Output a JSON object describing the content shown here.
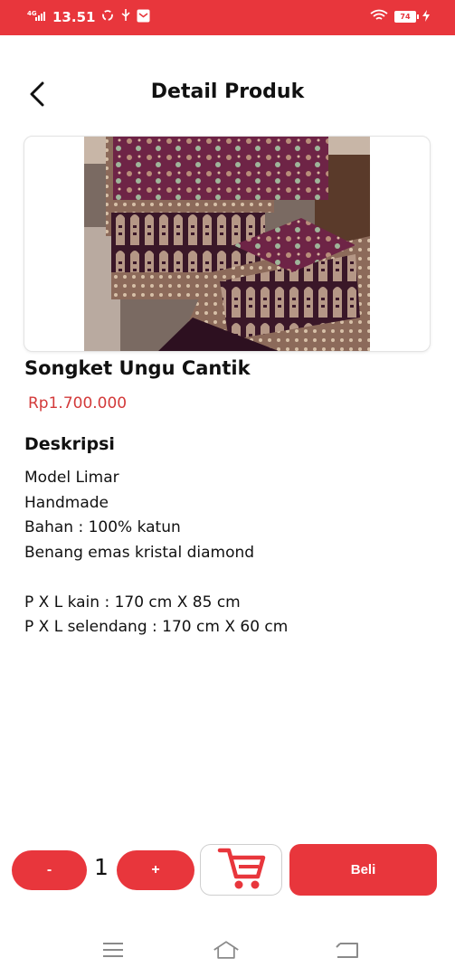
{
  "status_bar": {
    "network": "4G",
    "time": "13.51",
    "battery": "74"
  },
  "header": {
    "title": "Detail Produk"
  },
  "product": {
    "name": "Songket Ungu Cantik",
    "price": "Rp1.700.000",
    "description_title": "Deskripsi",
    "description_lines": [
      "Model Limar",
      "Handmade",
      "Bahan : 100% katun",
      "Benang emas kristal diamond",
      "",
      "P X L kain : 170 cm X 85 cm",
      "P X L selendang : 170 cm X 60 cm"
    ]
  },
  "actions": {
    "minus_label": "-",
    "quantity": "1",
    "plus_label": "+",
    "buy_label": "Beli"
  },
  "colors": {
    "accent": "#e8363c",
    "price": "#d33a3a"
  },
  "icons": [
    "back-arrow-icon",
    "cart-icon",
    "menu-icon",
    "home-icon",
    "back-nav-icon",
    "wifi-icon",
    "signal-icon"
  ]
}
